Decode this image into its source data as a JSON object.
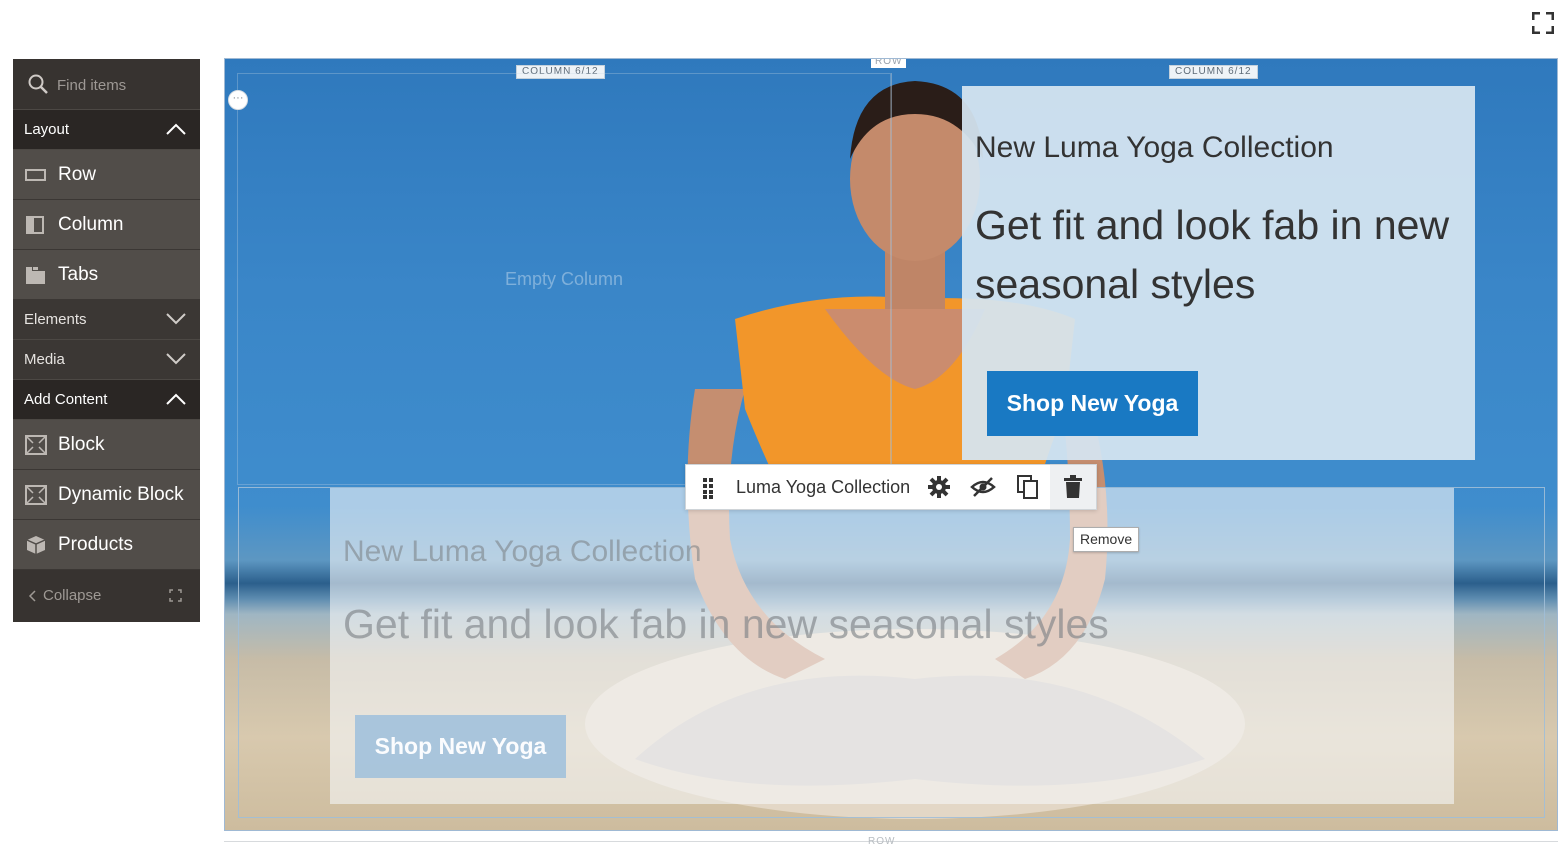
{
  "icons": {
    "fullscreen": "fullscreen-icon",
    "search": "search-icon",
    "row": "row-icon",
    "column": "column-icon",
    "tabs": "tabs-icon",
    "block": "block-icon",
    "dynamic_block": "dynamic-block-icon",
    "products": "products-icon"
  },
  "sidebar": {
    "search_placeholder": "Find items",
    "groups": {
      "layout": "Layout",
      "elements": "Elements",
      "media": "Media",
      "add_content": "Add Content"
    },
    "layout_items": [
      "Row",
      "Column",
      "Tabs"
    ],
    "content_items": [
      "Block",
      "Dynamic Block",
      "Products"
    ],
    "collapse_label": "Collapse"
  },
  "stage": {
    "row_label": "ROW",
    "column_label_left": "COLUMN 6/12",
    "column_label_right": "COLUMN 6/12",
    "empty_column_text": "Empty Column",
    "banner_top": {
      "title": "New Luma Yoga Collection",
      "subtitle": "Get fit and look fab in new seasonal styles",
      "button": "Shop New Yoga"
    },
    "banner_bottom": {
      "title": "New Luma Yoga Collection",
      "subtitle": "Get fit and look fab in new seasonal styles",
      "button": "Shop New Yoga"
    },
    "toolbar": {
      "title": "Luma Yoga Collection",
      "tooltip": "Remove"
    },
    "bottom_row_label": "ROW"
  },
  "colors": {
    "sidebar_bg": "#373330",
    "sidebar_item_bg": "#514d49",
    "accent_button": "#1979c3"
  }
}
